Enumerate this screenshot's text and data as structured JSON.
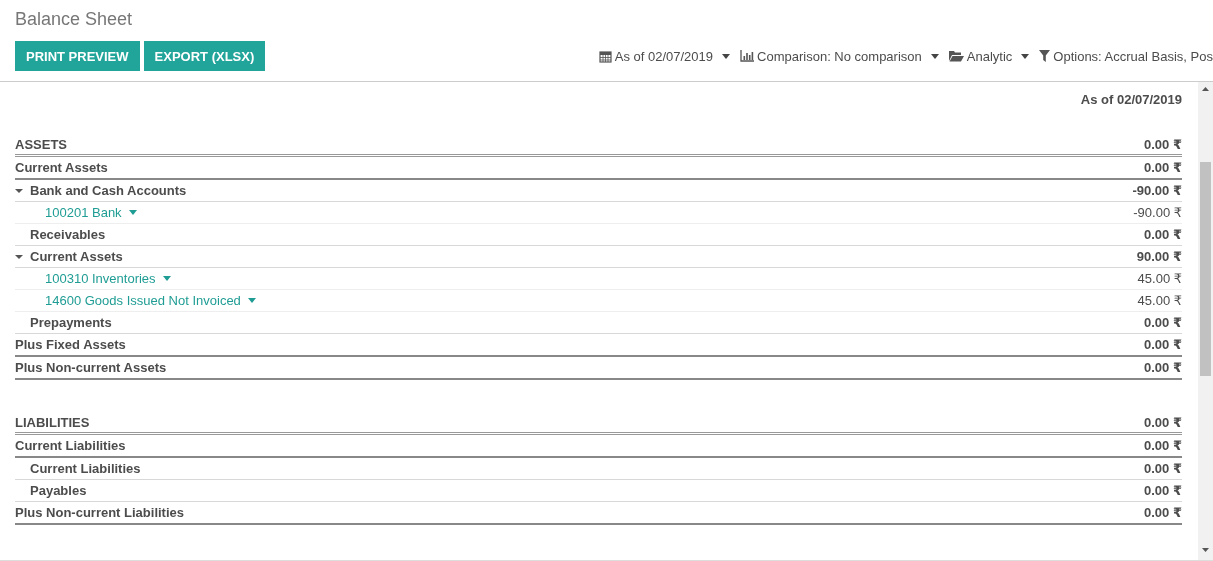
{
  "header": {
    "title": "Balance Sheet",
    "buttons": [
      {
        "label": "PRINT PREVIEW"
      },
      {
        "label": "EXPORT (XLSX)"
      }
    ],
    "filters": [
      {
        "label": "As of 02/07/2019",
        "dropdown": true
      },
      {
        "label": "Comparison: No comparison",
        "dropdown": true
      },
      {
        "label": "Analytic",
        "dropdown": true
      },
      {
        "label": "Options: Accrual Basis, Pos",
        "dropdown": false
      }
    ]
  },
  "report": {
    "column_heading": "As of 02/07/2019",
    "sections": [
      {
        "kind": "section",
        "label": "ASSETS",
        "amount": "0.00 ₹",
        "children": [
          {
            "kind": "total",
            "label": "Current Assets",
            "amount": "0.00 ₹",
            "children": [
              {
                "kind": "group",
                "label": "Bank and Cash Accounts",
                "amount": "-90.00 ₹",
                "expanded": true,
                "children": [
                  {
                    "kind": "account",
                    "label": "100201 Bank",
                    "amount": "-90.00 ₹"
                  }
                ]
              },
              {
                "kind": "line",
                "label": "Receivables",
                "amount": "0.00 ₹"
              },
              {
                "kind": "group",
                "label": "Current Assets",
                "amount": "90.00 ₹",
                "expanded": true,
                "children": [
                  {
                    "kind": "account",
                    "label": "100310 Inventories",
                    "amount": "45.00 ₹"
                  },
                  {
                    "kind": "account",
                    "label": "14600 Goods Issued Not Invoiced",
                    "amount": "45.00 ₹"
                  }
                ]
              },
              {
                "kind": "line",
                "label": "Prepayments",
                "amount": "0.00 ₹"
              }
            ]
          },
          {
            "kind": "total",
            "label": "Plus Fixed Assets",
            "amount": "0.00 ₹"
          },
          {
            "kind": "total",
            "label": "Plus Non-current Assets",
            "amount": "0.00 ₹"
          }
        ]
      },
      {
        "kind": "section",
        "label": "LIABILITIES",
        "amount": "0.00 ₹",
        "children": [
          {
            "kind": "total",
            "label": "Current Liabilities",
            "amount": "0.00 ₹",
            "children": [
              {
                "kind": "line",
                "label": "Current Liabilities",
                "amount": "0.00 ₹"
              },
              {
                "kind": "line",
                "label": "Payables",
                "amount": "0.00 ₹"
              }
            ]
          },
          {
            "kind": "total",
            "label": "Plus Non-current Liabilities",
            "amount": "0.00 ₹"
          }
        ]
      }
    ]
  }
}
